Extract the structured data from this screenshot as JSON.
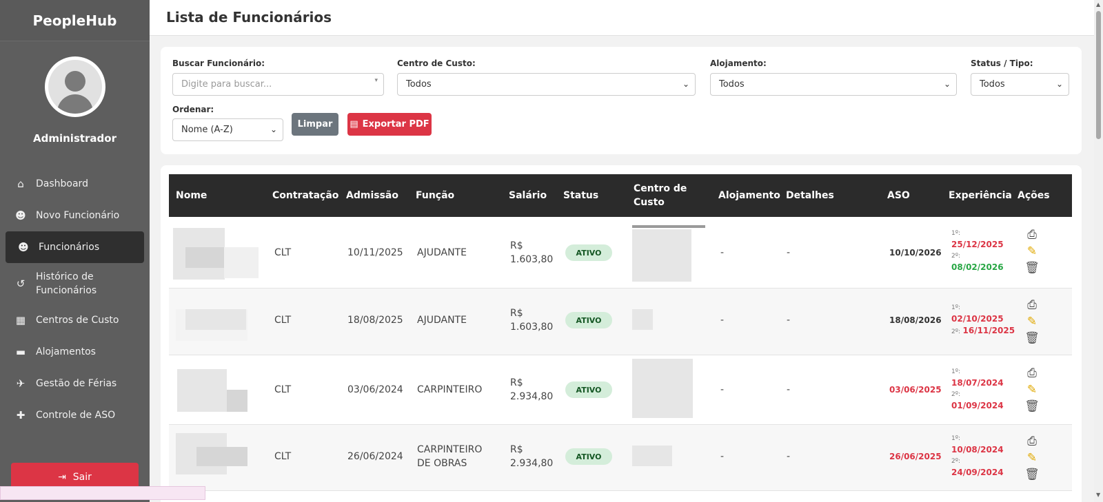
{
  "sidebar": {
    "brand": "PeopleHub",
    "user_name": "Administrador",
    "items": [
      {
        "label": "Dashboard",
        "icon": "home-icon"
      },
      {
        "label": "Novo Funcionário",
        "icon": "user-plus-icon"
      },
      {
        "label": "Funcionários",
        "icon": "users-icon",
        "active": true
      },
      {
        "label": "Histórico de Funcionários",
        "icon": "history-icon"
      },
      {
        "label": "Centros de Custo",
        "icon": "building-icon"
      },
      {
        "label": "Alojamentos",
        "icon": "bed-icon"
      },
      {
        "label": "Gestão de Férias",
        "icon": "plane-icon"
      },
      {
        "label": "Controle de ASO",
        "icon": "medical-icon"
      }
    ],
    "logout_label": "Sair"
  },
  "header": {
    "title": "Lista de Funcionários"
  },
  "filters": {
    "search_label": "Buscar Funcionário:",
    "search_placeholder": "Digite para buscar...",
    "cost_center_label": "Centro de Custo:",
    "cost_center_value": "Todos",
    "lodging_label": "Alojamento:",
    "lodging_value": "Todos",
    "status_label": "Status / Tipo:",
    "status_value": "Todos",
    "order_label": "Ordenar:",
    "order_value": "Nome (A-Z)",
    "clear_label": "Limpar",
    "export_label": "Exportar PDF"
  },
  "table": {
    "columns": [
      "Nome",
      "Contratação",
      "Admissão",
      "Função",
      "Salário",
      "Status",
      "Centro de Custo",
      "Alojamento",
      "Detalhes",
      "ASO",
      "Experiência",
      "Ações"
    ],
    "rows": [
      {
        "contratacao": "CLT",
        "admissao": "10/11/2025",
        "funcao": "AJUDANTE",
        "salario": "R$ 1.603,80",
        "status": "ATIVO",
        "alojamento": "-",
        "detalhes": "-",
        "aso": "10/10/2026",
        "aso_expired": false,
        "exp1_label": "1º:",
        "exp1": "25/12/2025",
        "exp1_color": "red",
        "exp2_label": "2º:",
        "exp2": "08/02/2026",
        "exp2_color": "green"
      },
      {
        "contratacao": "CLT",
        "admissao": "18/08/2025",
        "funcao": "AJUDANTE",
        "salario": "R$ 1.603,80",
        "status": "ATIVO",
        "alojamento": "-",
        "detalhes": "-",
        "aso": "18/08/2026",
        "aso_expired": false,
        "exp1_label": "1º:",
        "exp1": "02/10/2025",
        "exp1_color": "red",
        "exp2_label": "2º:",
        "exp2": "16/11/2025",
        "exp2_color": "red"
      },
      {
        "contratacao": "CLT",
        "admissao": "03/06/2024",
        "funcao": "CARPINTEIRO",
        "salario": "R$ 2.934,80",
        "status": "ATIVO",
        "alojamento": "-",
        "detalhes": "-",
        "aso": "03/06/2025",
        "aso_expired": true,
        "exp1_label": "1º:",
        "exp1": "18/07/2024",
        "exp1_color": "red",
        "exp2_label": "2º:",
        "exp2": "01/09/2024",
        "exp2_color": "red"
      },
      {
        "contratacao": "CLT",
        "admissao": "26/06/2024",
        "funcao": "CARPINTEIRO DE OBRAS",
        "salario": "R$ 2.934,80",
        "status": "ATIVO",
        "alojamento": "-",
        "detalhes": "-",
        "aso": "26/06/2025",
        "aso_expired": true,
        "exp1_label": "1º:",
        "exp1": "10/08/2024",
        "exp1_color": "red",
        "exp2_label": "2º:",
        "exp2": "24/09/2024",
        "exp2_color": "red"
      }
    ]
  },
  "colors": {
    "sidebar_bg": "#5e5e5e",
    "active_bg": "#2f2f2f",
    "danger": "#dc3545",
    "success": "#28a745",
    "table_header": "#2b2b2b"
  }
}
